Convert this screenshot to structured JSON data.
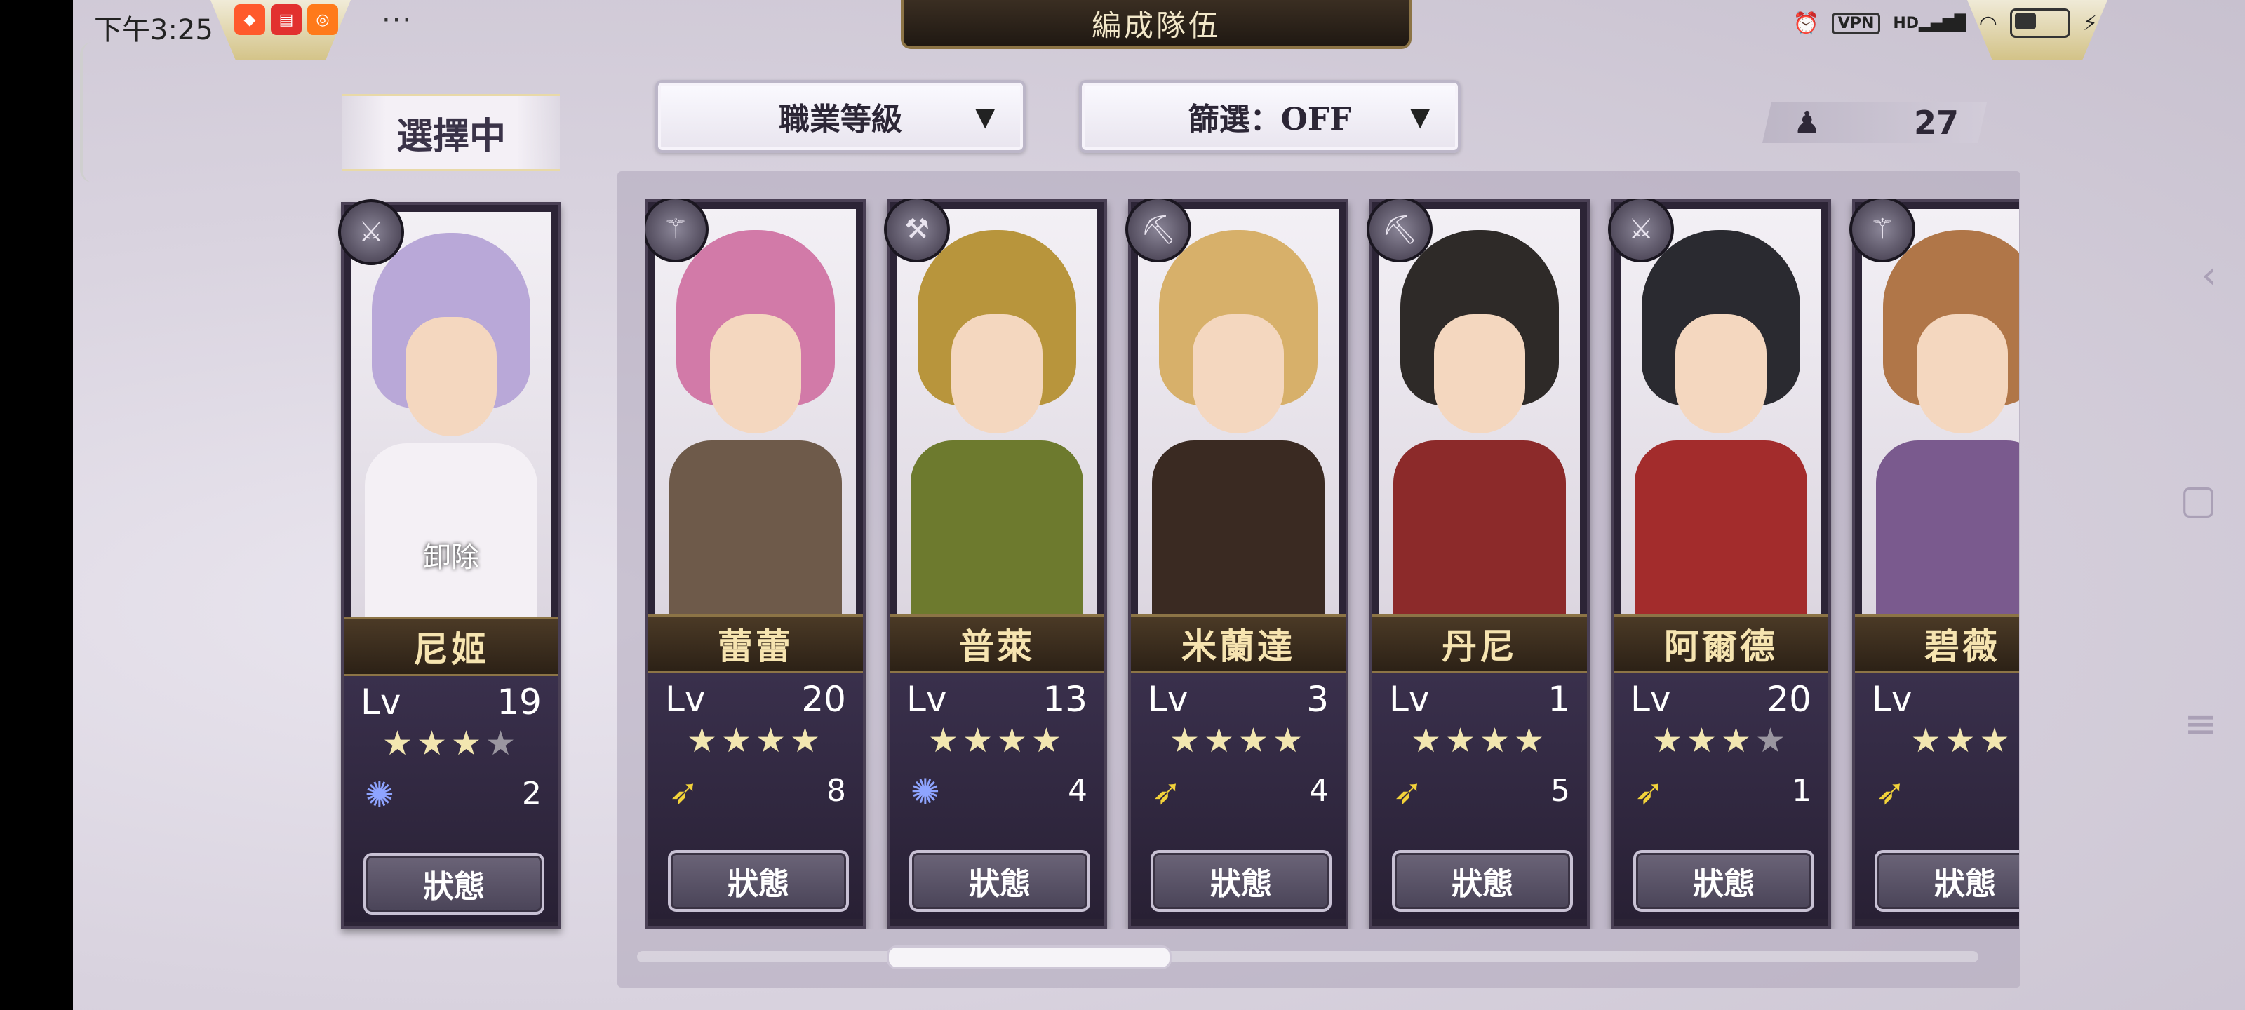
{
  "status_bar": {
    "time": "下午3:25",
    "more": "···",
    "vpn": "VPN",
    "network": "HD"
  },
  "header": {
    "title": "編成隊伍"
  },
  "selected_label": "選擇中",
  "sort_dropdown": {
    "value": "職業等級",
    "arrow": "▼"
  },
  "filter_dropdown": {
    "value": "篩選：OFF",
    "arrow": "▼"
  },
  "unit_count": {
    "value": "27"
  },
  "unequip_label": "卸除",
  "status_button_label": "狀態",
  "lv_label": "Lv",
  "selected_unit": {
    "name": "尼姬",
    "level": "19",
    "stars": "★★★",
    "stars_off": "★",
    "element": "swirl",
    "cost": "2",
    "hair": "#b9a8d8",
    "outfit": "#f4f0f5",
    "badge": "sword-icon"
  },
  "units": [
    {
      "name": "蕾蕾",
      "level": "20",
      "stars": "★★★★",
      "stars_off": "",
      "element": "wind",
      "cost": "8",
      "hair": "#d27aa8",
      "outfit": "#6e5a4a",
      "badge": "staff-icon"
    },
    {
      "name": "普萊",
      "level": "13",
      "stars": "★★★★",
      "stars_off": "",
      "element": "swirl",
      "cost": "4",
      "hair": "#b8953c",
      "outfit": "#6d7a2e",
      "badge": "hammer-icon"
    },
    {
      "name": "米蘭達",
      "level": "3",
      "stars": "★★★★",
      "stars_off": "",
      "element": "wind",
      "cost": "4",
      "hair": "#d7b06a",
      "outfit": "#3a2a22",
      "badge": "axe-icon"
    },
    {
      "name": "丹尼",
      "level": "1",
      "stars": "★★★★",
      "stars_off": "",
      "element": "wind",
      "cost": "5",
      "hair": "#2e2a28",
      "outfit": "#8c2a2a",
      "badge": "axe-icon"
    },
    {
      "name": "阿爾德",
      "level": "20",
      "stars": "★★★",
      "stars_off": "★",
      "element": "wind",
      "cost": "1",
      "hair": "#2a2a30",
      "outfit": "#a32c2c",
      "badge": "sword-icon"
    },
    {
      "name": "碧薇",
      "level": "",
      "stars": "★★★",
      "stars_off": "",
      "element": "wind",
      "cost": "",
      "hair": "#b07648",
      "outfit": "#7a5a8e",
      "badge": "staff-icon"
    }
  ],
  "colors": {
    "accent_gold": "#8c7446",
    "name_text": "#f6e4b0",
    "panel": "#afa6b9"
  }
}
